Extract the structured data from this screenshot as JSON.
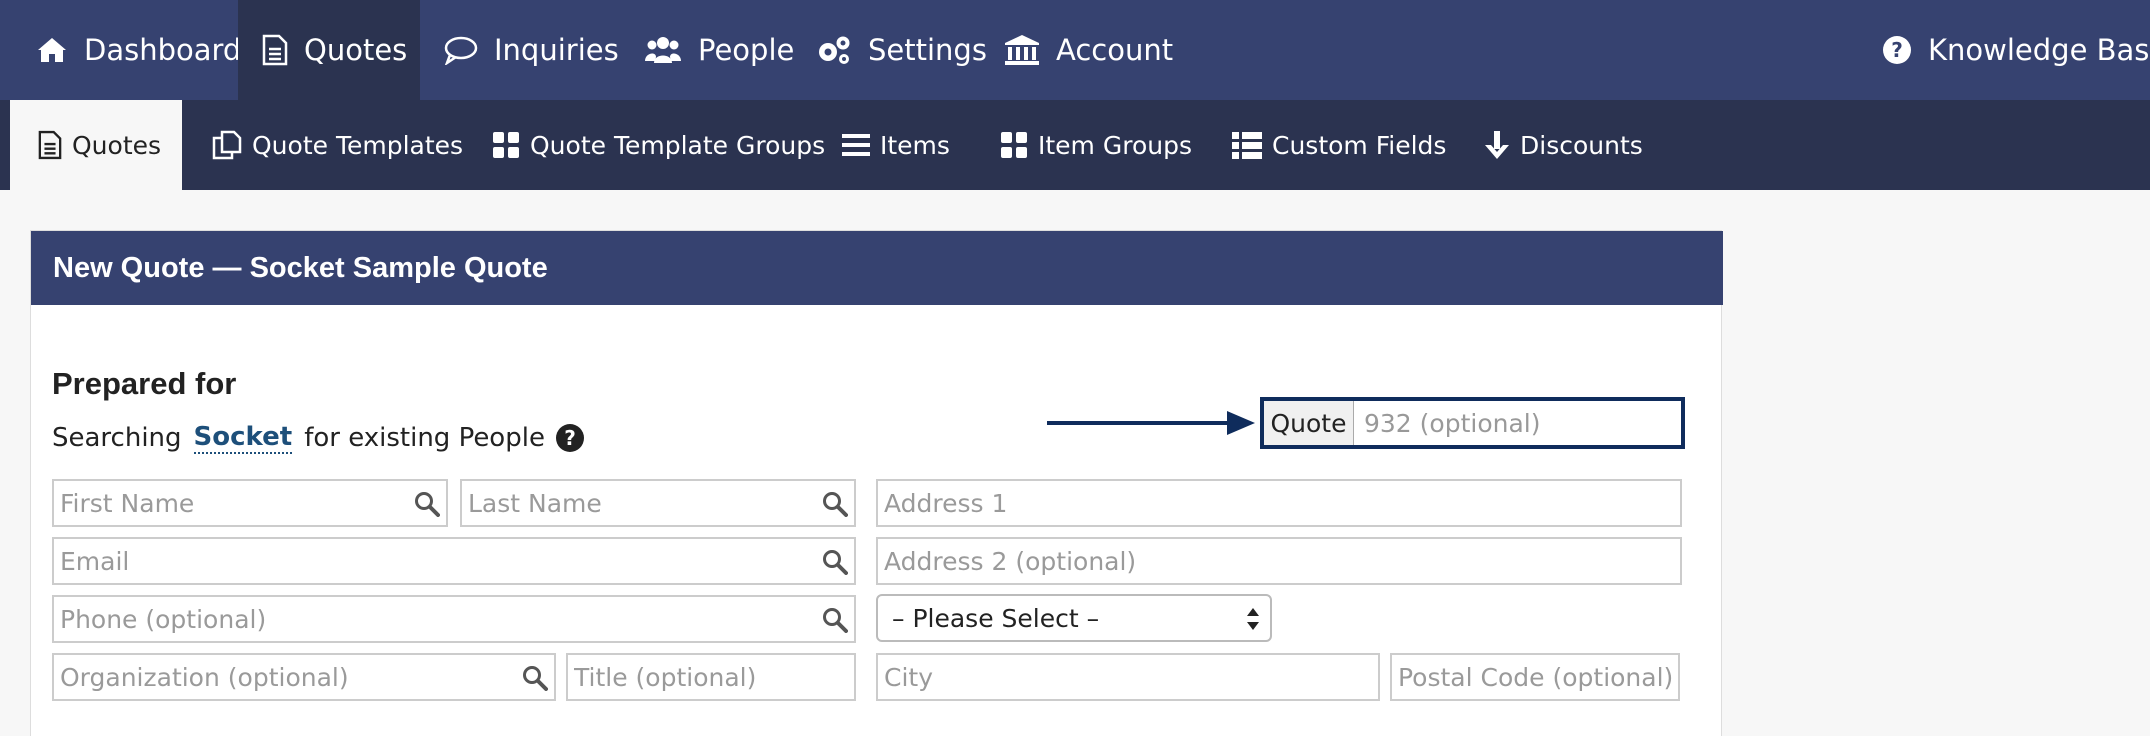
{
  "topnav": {
    "items": [
      {
        "label": "Dashboard",
        "icon": "home-icon"
      },
      {
        "label": "Quotes",
        "icon": "document-icon",
        "active": true
      },
      {
        "label": "Inquiries",
        "icon": "speech-bubble-icon"
      },
      {
        "label": "People",
        "icon": "users-icon"
      },
      {
        "label": "Settings",
        "icon": "gears-icon"
      },
      {
        "label": "Account",
        "icon": "bank-icon"
      }
    ],
    "help": {
      "label": "Knowledge Base",
      "icon": "question-circle-icon"
    }
  },
  "subnav": {
    "items": [
      {
        "label": "Quotes",
        "icon": "document-icon",
        "active": true
      },
      {
        "label": "Quote Templates",
        "icon": "copy-icon"
      },
      {
        "label": "Quote Template Groups",
        "icon": "grid-icon"
      },
      {
        "label": "Items",
        "icon": "list-icon"
      },
      {
        "label": "Item Groups",
        "icon": "grid-icon"
      },
      {
        "label": "Custom Fields",
        "icon": "list-grid-icon"
      },
      {
        "label": "Discounts",
        "icon": "arrow-down-icon"
      }
    ]
  },
  "panel": {
    "title": "New Quote — Socket Sample Quote",
    "prepared_for": "Prepared for",
    "searching_prefix": "Searching",
    "searching_link": "Socket",
    "searching_suffix": "for existing People"
  },
  "quote_field": {
    "addon": "Quote",
    "placeholder": "932 (optional)"
  },
  "form": {
    "first_name": "First Name",
    "last_name": "Last Name",
    "email": "Email",
    "phone": "Phone (optional)",
    "organization": "Organization (optional)",
    "title": "Title (optional)",
    "address1": "Address 1",
    "address2": "Address 2 (optional)",
    "state_select": "– Please Select –",
    "city": "City",
    "postal": "Postal Code (optional)"
  },
  "colors": {
    "nav_bg": "#364270",
    "subnav_bg": "#2b3350",
    "link": "#1d4f7a",
    "highlight_border": "#0f2c5c"
  }
}
